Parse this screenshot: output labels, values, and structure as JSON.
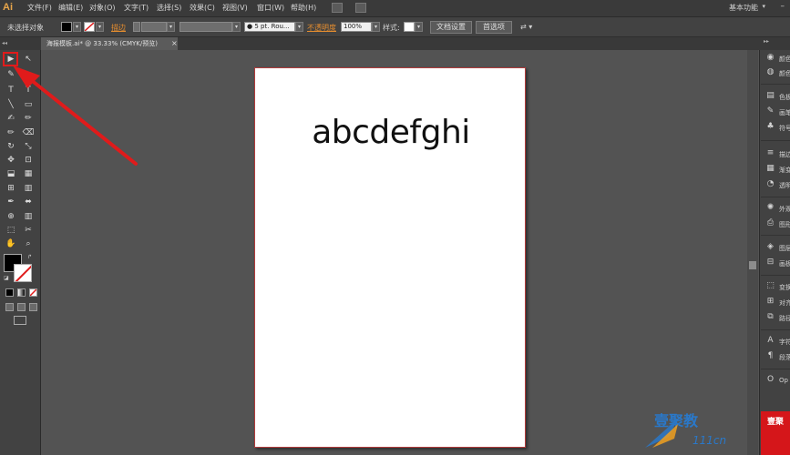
{
  "app": {
    "logo": "Ai",
    "workspace": "基本功能"
  },
  "menu": [
    "文件(F)",
    "编辑(E)",
    "对象(O)",
    "文字(T)",
    "选择(S)",
    "效果(C)",
    "视图(V)",
    "窗口(W)",
    "帮助(H)"
  ],
  "control_bar": {
    "selection_status": "未选择对象",
    "stroke_label": "描边",
    "brush_value": "5 pt. Rou...",
    "opacity_label": "不透明度",
    "opacity_value": "100%",
    "style_label": "样式:",
    "doc_setup_button": "文档设置",
    "preferences_button": "首选项"
  },
  "tab": {
    "title": "海报模板.ai* @ 33.33% (CMYK/预览)",
    "close": "×"
  },
  "toolbox": {
    "grip": "◂◂",
    "tools": [
      "▶",
      "↖",
      "✎",
      "T",
      "╲",
      "▭",
      "✍",
      "✏",
      "⌫",
      "✂",
      "↻",
      "⤡",
      "✥",
      "▦",
      "⊡",
      "⬚",
      "⬓",
      "◐",
      "✒",
      "⬌",
      "⊞",
      "▥",
      "⊕",
      "⊘",
      "✋",
      "⌕"
    ]
  },
  "artboard": {
    "text": "abcdefghi"
  },
  "panels": [
    {
      "icon": "◉",
      "label": "颜色"
    },
    {
      "icon": "◍",
      "label": "颜色"
    },
    {
      "icon": "▤",
      "label": "色板"
    },
    {
      "icon": "✎",
      "label": "画笔"
    },
    {
      "icon": "♣",
      "label": "符号"
    },
    {
      "icon": "≡",
      "label": "描边"
    },
    {
      "icon": "▦",
      "label": "渐变"
    },
    {
      "icon": "◔",
      "label": "透明"
    },
    {
      "icon": "✺",
      "label": "外观"
    },
    {
      "icon": "⎙",
      "label": "图形"
    },
    {
      "icon": "◈",
      "label": "图层"
    },
    {
      "icon": "⊟",
      "label": "画板"
    },
    {
      "icon": "⬚",
      "label": "变换"
    },
    {
      "icon": "⊞",
      "label": "对齐"
    },
    {
      "icon": "⧉",
      "label": "路径"
    },
    {
      "icon": "A",
      "label": "字符"
    },
    {
      "icon": "¶",
      "label": "段落"
    },
    {
      "icon": "O",
      "label": "Op"
    }
  ],
  "watermark": {
    "text": "壹聚教",
    "url": "111cn",
    "stamp": "壹聚"
  },
  "colors": {
    "arrow": "#e01b1b",
    "accent_orange": "#e58d2f",
    "watermark_blue": "#2a78c8"
  }
}
